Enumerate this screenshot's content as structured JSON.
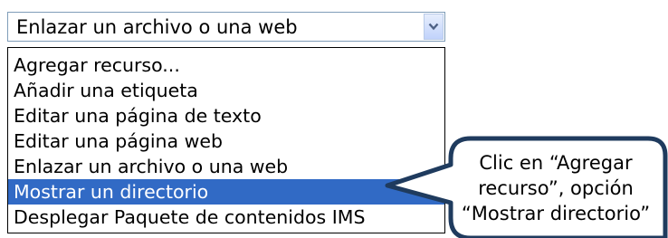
{
  "select": {
    "value": "Enlazar un archivo o una web"
  },
  "dropdown": {
    "options": [
      "Agregar recurso...",
      "Añadir una etiqueta",
      "Editar una página de texto",
      "Editar una página web",
      "Enlazar un archivo o una web",
      "Mostrar un directorio",
      "Desplegar Paquete de contenidos IMS"
    ],
    "highlighted_option": "Mostrar un directorio"
  },
  "callout": {
    "lines": [
      "Clic en “Agregar",
      "recurso”, opción",
      "“Mostrar directorio”"
    ]
  },
  "colors": {
    "highlight": "#316ac5",
    "callout_border": "#1f3b5e",
    "select_border": "#7f9db9"
  },
  "icons": {
    "select_arrow": "chevron-down-icon"
  }
}
